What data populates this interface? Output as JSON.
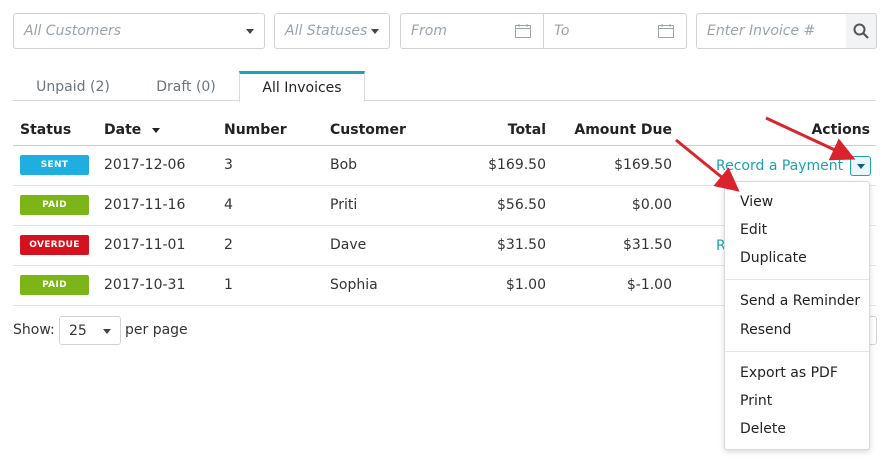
{
  "filters": {
    "customers": "All Customers",
    "statuses": "All Statuses",
    "from": "From",
    "to": "To",
    "invoice_placeholder": "Enter Invoice #"
  },
  "tabs": [
    {
      "label": "Unpaid (2)"
    },
    {
      "label": "Draft (0)"
    },
    {
      "label": "All Invoices",
      "active": true
    }
  ],
  "table": {
    "headers": {
      "status": "Status",
      "date": "Date",
      "number": "Number",
      "customer": "Customer",
      "total": "Total",
      "amount_due": "Amount Due",
      "actions": "Actions"
    },
    "rows": [
      {
        "status": "SENT",
        "status_color": "#1eaee0",
        "date": "2017-12-06",
        "number": "3",
        "customer": "Bob",
        "total": "$169.50",
        "amount_due": "$169.50",
        "action": "Record a Payment"
      },
      {
        "status": "PAID",
        "status_color": "#7cb518",
        "date": "2017-11-16",
        "number": "4",
        "customer": "Priti",
        "total": "$56.50",
        "amount_due": "$0.00",
        "action": ""
      },
      {
        "status": "OVERDUE",
        "status_color": "#d4111e",
        "date": "2017-11-01",
        "number": "2",
        "customer": "Dave",
        "total": "$31.50",
        "amount_due": "$31.50",
        "action": "R"
      },
      {
        "status": "PAID",
        "status_color": "#7cb518",
        "date": "2017-10-31",
        "number": "1",
        "customer": "Sophia",
        "total": "$1.00",
        "amount_due": "$-1.00",
        "action": ""
      }
    ]
  },
  "pager": {
    "show_label": "Show:",
    "per_page_value": "25",
    "per_page_label": "per page"
  },
  "menu": {
    "items": [
      "View",
      "Edit",
      "Duplicate",
      "Send a Reminder",
      "Resend",
      "Export as PDF",
      "Print",
      "Delete"
    ]
  },
  "colors": {
    "accent": "#1da1b7",
    "arrow": "#d9232d"
  }
}
